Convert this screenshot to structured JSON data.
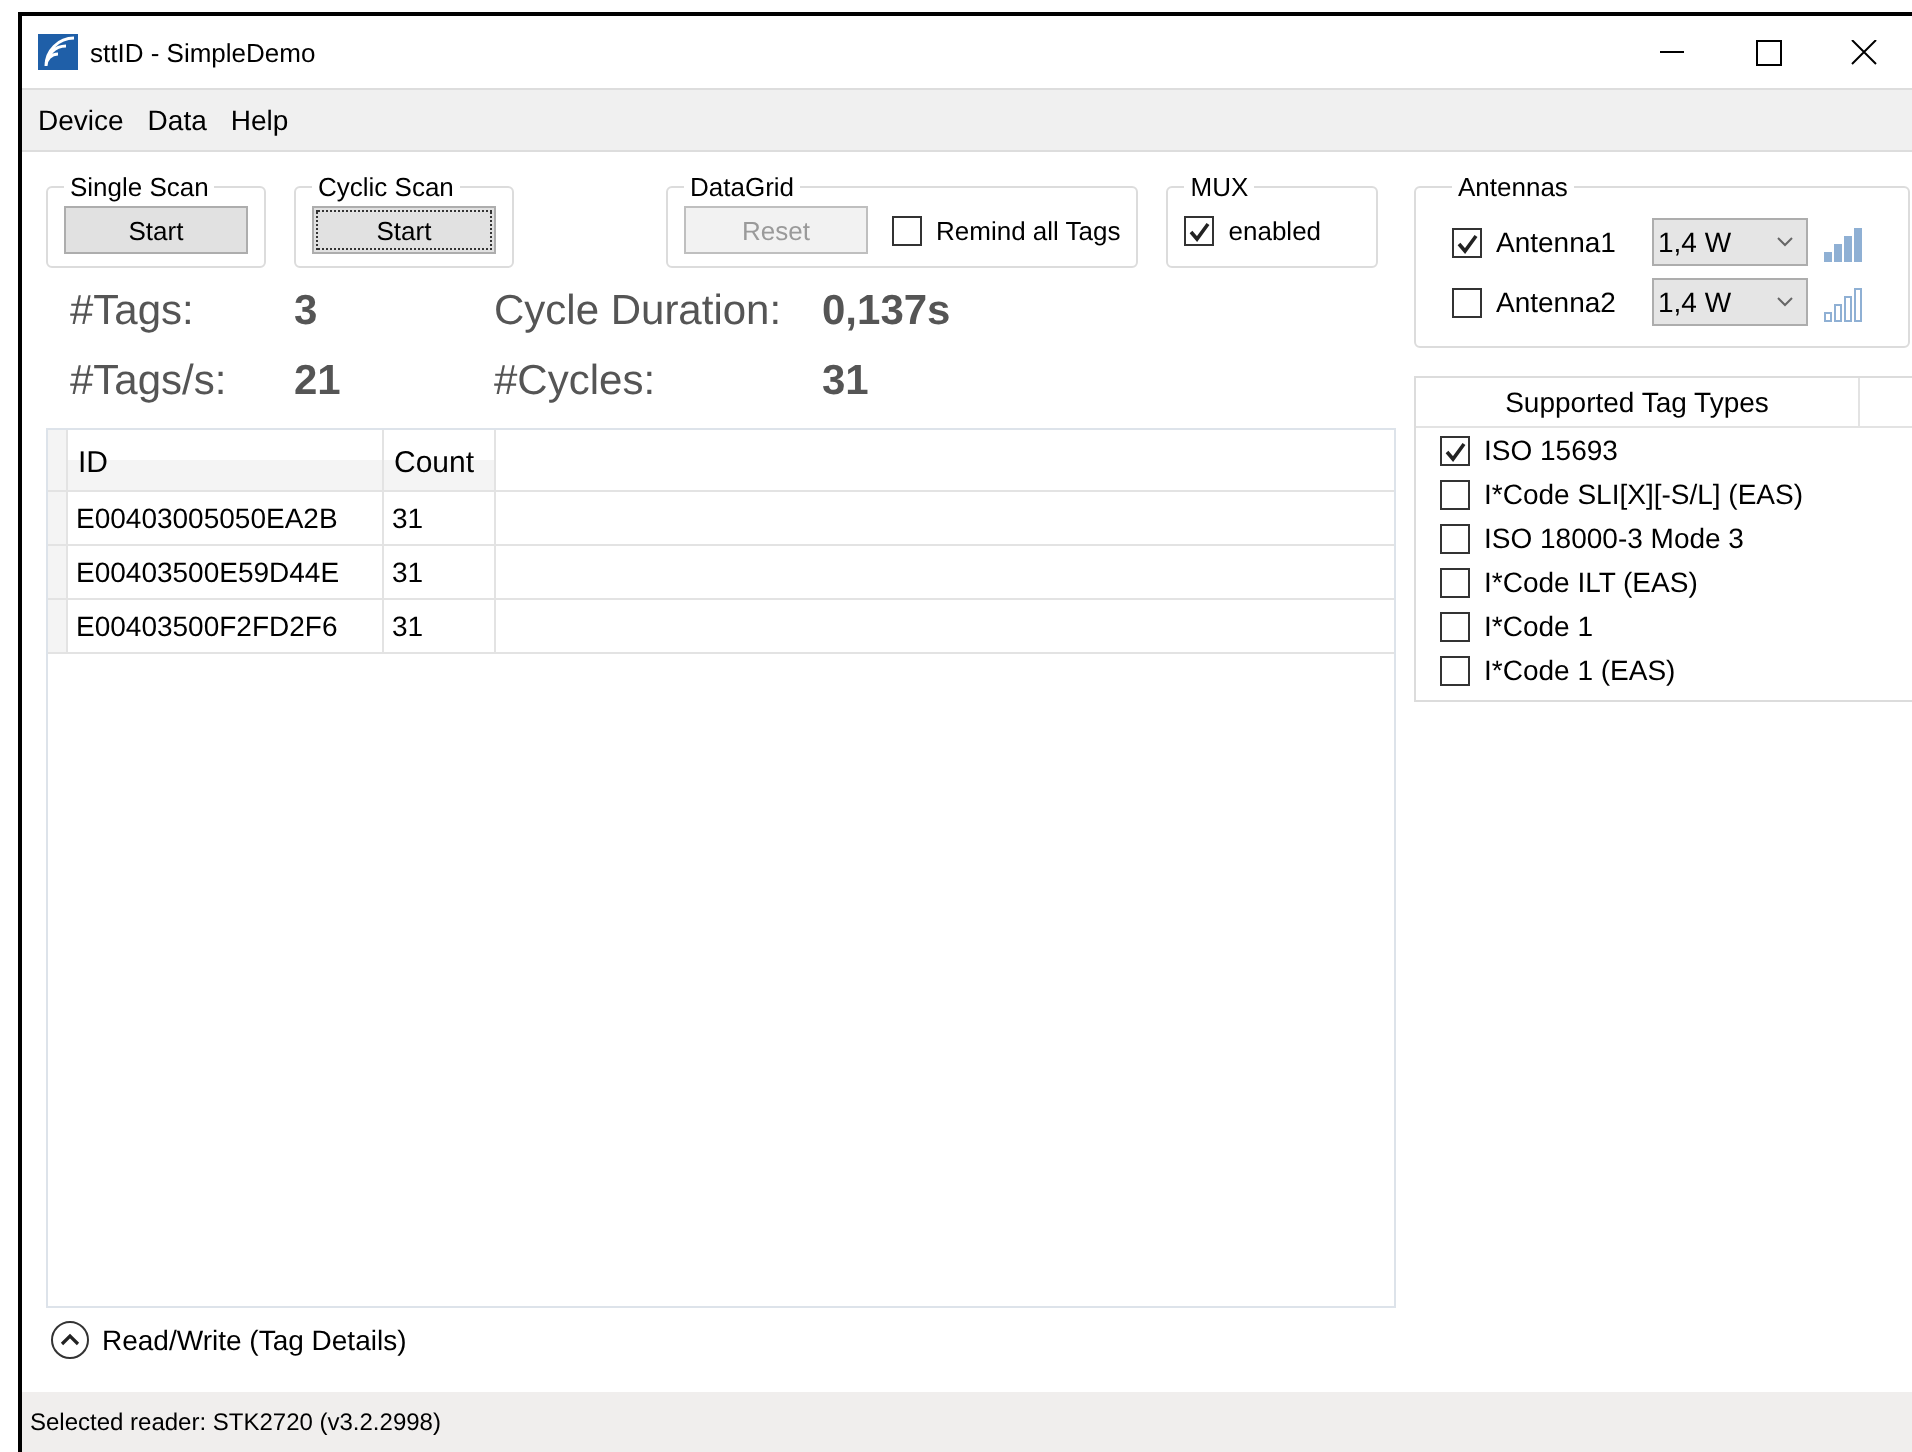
{
  "window": {
    "title": "sttID - SimpleDemo"
  },
  "menu": [
    "Device",
    "Data",
    "Help"
  ],
  "groups": [
    {
      "title": "Single Scan",
      "kind": "button",
      "button": {
        "label": "Start",
        "disabled": false,
        "focused": false
      }
    },
    {
      "title": "Cyclic Scan",
      "kind": "button",
      "button": {
        "label": "Start",
        "disabled": false,
        "focused": true
      }
    },
    {
      "title": "DataGrid",
      "kind": "button_checkbox",
      "button": {
        "label": "Reset",
        "disabled": true,
        "focused": false
      },
      "checkbox": {
        "label": "Remind all Tags",
        "checked": false
      }
    },
    {
      "title": "MUX",
      "kind": "checkbox",
      "checkbox": {
        "label": "enabled",
        "checked": true
      }
    }
  ],
  "antennas": {
    "title": "Antennas",
    "items": [
      {
        "label": "Antenna1",
        "checked": true,
        "power": "1,4 W"
      },
      {
        "label": "Antenna2",
        "checked": false,
        "power": "1,4 W"
      }
    ]
  },
  "stats": [
    {
      "label": "#Tags:",
      "value": "3"
    },
    {
      "label": "Cycle Duration:",
      "value": "0,137s"
    },
    {
      "label": "#Tags/s:",
      "value": "21"
    },
    {
      "label": "#Cycles:",
      "value": "31"
    }
  ],
  "table": {
    "columns": [
      "ID",
      "Count"
    ],
    "rows": [
      [
        "E00403005050EA2B",
        "31"
      ],
      [
        "E00403500E59D44E",
        "31"
      ],
      [
        "E00403500F2FD2F6",
        "31"
      ]
    ]
  },
  "tag_types": {
    "header": "Supported Tag Types",
    "items": [
      {
        "label": "ISO 15693",
        "checked": true
      },
      {
        "label": "I*Code SLI[X][-S/L] (EAS)",
        "checked": false
      },
      {
        "label": "ISO 18000-3 Mode 3",
        "checked": false
      },
      {
        "label": "I*Code ILT (EAS)",
        "checked": false
      },
      {
        "label": "I*Code 1",
        "checked": false
      },
      {
        "label": "I*Code 1 (EAS)",
        "checked": false
      }
    ]
  },
  "expander": {
    "label": "Read/Write (Tag Details)",
    "expanded": true
  },
  "status_bar": "Selected reader: STK2720 (v3.2.2998)"
}
